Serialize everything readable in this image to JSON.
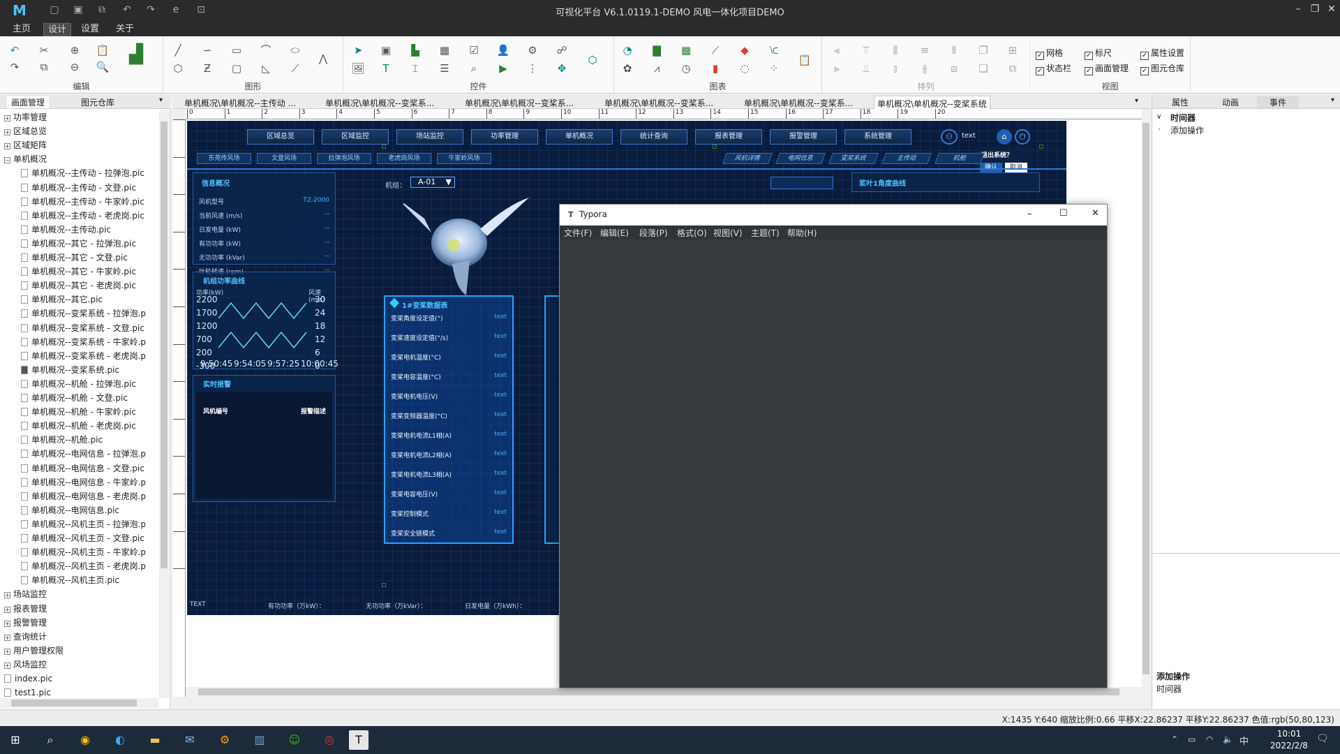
{
  "title_bar": {
    "title": "可视化平台 V6.1.0119.1-DEMO 风电一体化项目DEMO",
    "logo": "M"
  },
  "menu": [
    "主页",
    "设计",
    "设置",
    "关于"
  ],
  "ribbon": {
    "groups": [
      "编辑",
      "图形",
      "控件",
      "图表",
      "排列",
      "视图"
    ],
    "view_checks": [
      {
        "label": "网格",
        "checked": true
      },
      {
        "label": "标尺",
        "checked": true
      },
      {
        "label": "属性设置",
        "checked": true
      },
      {
        "label": "状态栏",
        "checked": true
      },
      {
        "label": "画面管理",
        "checked": true
      },
      {
        "label": "图元仓库",
        "checked": true
      }
    ]
  },
  "left_panel": {
    "tabs": [
      "画面管理",
      "图元仓库"
    ],
    "tree": [
      {
        "label": "功率管理",
        "level": 0,
        "folder": true
      },
      {
        "label": "区域总览",
        "level": 0,
        "folder": true
      },
      {
        "label": "区域矩阵",
        "level": 0,
        "folder": true
      },
      {
        "label": "单机概况",
        "level": 0,
        "folder": true,
        "open": true
      },
      {
        "label": "单机概况--主传动 - 拉弹泡.pic",
        "level": 1
      },
      {
        "label": "单机概况--主传动 - 文登.pic",
        "level": 1
      },
      {
        "label": "单机概况--主传动 - 牛家岭.pic",
        "level": 1
      },
      {
        "label": "单机概况--主传动 - 老虎岗.pic",
        "level": 1
      },
      {
        "label": "单机概况--主传动.pic",
        "level": 1
      },
      {
        "label": "单机概况--其它 - 拉弹泡.pic",
        "level": 1
      },
      {
        "label": "单机概况--其它 - 文登.pic",
        "level": 1
      },
      {
        "label": "单机概况--其它 - 牛家岭.pic",
        "level": 1
      },
      {
        "label": "单机概况--其它 - 老虎岗.pic",
        "level": 1
      },
      {
        "label": "单机概况--其它.pic",
        "level": 1
      },
      {
        "label": "单机概况--变桨系统 - 拉弹泡.p",
        "level": 1
      },
      {
        "label": "单机概况--变桨系统 - 文登.pic",
        "level": 1
      },
      {
        "label": "单机概况--变桨系统 - 牛家岭.p",
        "level": 1
      },
      {
        "label": "单机概况--变桨系统 - 老虎岗.p",
        "level": 1
      },
      {
        "label": "单机概况--变桨系统.pic",
        "level": 1,
        "active": true
      },
      {
        "label": "单机概况--机舱 - 拉弹泡.pic",
        "level": 1
      },
      {
        "label": "单机概况--机舱 - 文登.pic",
        "level": 1
      },
      {
        "label": "单机概况--机舱 - 牛家岭.pic",
        "level": 1
      },
      {
        "label": "单机概况--机舱 - 老虎岗.pic",
        "level": 1
      },
      {
        "label": "单机概况--机舱.pic",
        "level": 1
      },
      {
        "label": "单机概况--电网信息 - 拉弹泡.p",
        "level": 1
      },
      {
        "label": "单机概况--电网信息 - 文登.pic",
        "level": 1
      },
      {
        "label": "单机概况--电网信息 - 牛家岭.p",
        "level": 1
      },
      {
        "label": "单机概况--电网信息 - 老虎岗.p",
        "level": 1
      },
      {
        "label": "单机概况--电网信息.pic",
        "level": 1
      },
      {
        "label": "单机概况--风机主页 - 拉弹泡.p",
        "level": 1
      },
      {
        "label": "单机概况--风机主页 - 文登.pic",
        "level": 1
      },
      {
        "label": "单机概况--风机主页 - 牛家岭.p",
        "level": 1
      },
      {
        "label": "单机概况--风机主页 - 老虎岗.p",
        "level": 1
      },
      {
        "label": "单机概况--风机主页.pic",
        "level": 1
      },
      {
        "label": "场站监控",
        "level": 0,
        "folder": true
      },
      {
        "label": "报表管理",
        "level": 0,
        "folder": true
      },
      {
        "label": "报警管理",
        "level": 0,
        "folder": true
      },
      {
        "label": "查询统计",
        "level": 0,
        "folder": true
      },
      {
        "label": "用户管理权限",
        "level": 0,
        "folder": true
      },
      {
        "label": "风场监控",
        "level": 0,
        "folder": true
      },
      {
        "label": "index.pic",
        "level": 0
      },
      {
        "label": "test1.pic",
        "level": 0
      }
    ]
  },
  "doc_tabs": [
    "单机概况\\单机概况--主传动 ...",
    "单机概况\\单机概况--变桨系...",
    "单机概况\\单机概况--变桨系...",
    "单机概况\\单机概况--变桨系...",
    "单机概况\\单机概况--变桨系...",
    "单机概况\\单机概况--变桨系统"
  ],
  "ruler_labels": [
    "0",
    "1",
    "2",
    "3",
    "4",
    "5",
    "6",
    "7",
    "8",
    "9",
    "10",
    "11",
    "12",
    "13",
    "14",
    "15",
    "16",
    "17",
    "18",
    "19",
    "20"
  ],
  "design": {
    "nav": [
      "区域总览",
      "区域监控",
      "场站监控",
      "功率管理",
      "单机概况",
      "统计查询",
      "报表管理",
      "报警管理",
      "系统管理"
    ],
    "user_text": "text",
    "sub_left": [
      "东苑传风场",
      "文登风场",
      "拉弹泡风场",
      "老虎岗风场",
      "牛家岭风场"
    ],
    "sub_right": [
      "风机详情",
      "电网信息",
      "变桨系统",
      "主传动",
      "机舱"
    ],
    "exit_dialog": {
      "title": "退出系统？",
      "ok": "确认",
      "cancel": "取消"
    },
    "info_title": "信息概况",
    "machine_label": "机组：",
    "machine_value": "A-01",
    "info_rows": [
      {
        "k": "风机型号",
        "v": "TZ-2000"
      },
      {
        "k": "当前风速 (m/s)",
        "v": "--"
      },
      {
        "k": "日发电量 (kW)",
        "v": "--"
      },
      {
        "k": "有功功率 (kW)",
        "v": "--"
      },
      {
        "k": "无功功率 (kVar)",
        "v": "--"
      },
      {
        "k": "叶轮转速 (rpm)",
        "v": "--"
      }
    ],
    "curve_title": "机组功率曲线",
    "curve_left_label": "功率(kW)",
    "curve_right_label": "风速(m/s)",
    "curve_left_ticks": [
      "2200",
      "1700",
      "1200",
      "700",
      "200",
      "-300"
    ],
    "curve_right_ticks": [
      "30",
      "24",
      "18",
      "12",
      "6",
      "0"
    ],
    "curve_x_ticks": [
      "9:50:45",
      "9:54:05",
      "9:57:25",
      "10:00:45"
    ],
    "alarm_title": "实时报警",
    "alarm_cols": [
      "风机编号",
      "报警描述"
    ],
    "pitch_title": "1#变桨数据表",
    "pitch_rows": [
      "变桨角度设定值(°)",
      "变桨速度设定值(°/s)",
      "变桨电机温度(°C)",
      "变桨电容温度(°C)",
      "变桨电机电压(V)",
      "变桨变频器温度(°C)",
      "变桨电机电流L1相(A)",
      "变桨电机电流L2相(A)",
      "变桨电机电流L3相(A)",
      "变桨电容电压(V)",
      "变桨控制模式",
      "变桨安全链模式"
    ],
    "pitch_value": "text",
    "angle_title": "浆叶1角度曲线",
    "bottom_bar": [
      "TEXT",
      "有功功率（万kW）：",
      "无功功率（万kVar）：",
      "日发电量（万kWh）："
    ]
  },
  "typora": {
    "title": "Typora",
    "menu": [
      "文件(F)",
      "编辑(E)",
      "段落(P)",
      "格式(O)",
      "视图(V)",
      "主题(T)",
      "帮助(H)"
    ]
  },
  "right_panel": {
    "tabs": [
      "属性",
      "动画",
      "事件"
    ],
    "tree_root": "时间器",
    "tree_child": "添加操作",
    "bottom_title": "添加操作",
    "bottom_sub": "时间器"
  },
  "status": "X:1435 Y:640   缩放比例:0.66 平移X:22.86237 平移Y:22.86237 色值:rgb(50,80,123)",
  "taskbar": {
    "time": "10:01",
    "date": "2022/2/8",
    "ime": "中"
  }
}
